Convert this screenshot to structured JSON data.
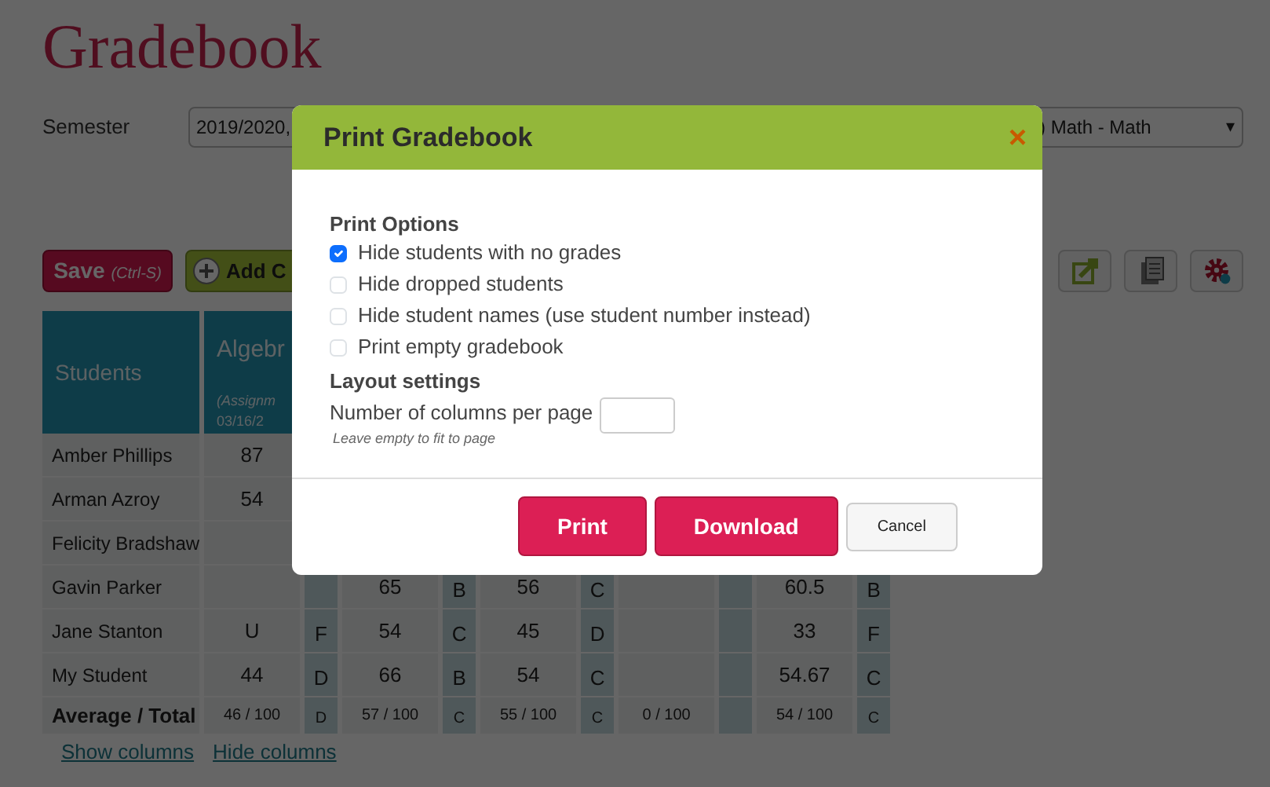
{
  "page_title": "Gradebook",
  "filters": [
    {
      "label": "Semester",
      "value": "2019/2020,"
    },
    {
      "value": ") Math - Math",
      "caret": "▾"
    }
  ],
  "toolbar": {
    "save": {
      "label": "Save",
      "shortcut": "(Ctrl-S)"
    },
    "add": {
      "label": "Add C"
    }
  },
  "table": {
    "columns": [
      {
        "label": "Students"
      },
      {
        "label": "Algebr",
        "subtitle": "(Assignm",
        "date": "03/16/2"
      }
    ],
    "rows": [
      {
        "cells": [
          "Amber Phillips",
          "87"
        ]
      },
      {
        "cells": [
          "Arman Azroy",
          "54"
        ]
      },
      {
        "cells": [
          "Felicity Bradshaw",
          ""
        ]
      },
      {
        "cells": [
          "Gavin Parker",
          "",
          "",
          "65",
          "B",
          "56",
          "C",
          "",
          "",
          "60.5",
          "B"
        ]
      },
      {
        "cells": [
          "Jane Stanton",
          "U",
          "F",
          "54",
          "C",
          "45",
          "D",
          "",
          "",
          "33",
          "F"
        ]
      },
      {
        "cells": [
          "My Student",
          "44",
          "D",
          "66",
          "B",
          "54",
          "C",
          "",
          "",
          "54.67",
          "C"
        ]
      },
      {
        "kind": "total",
        "cells": [
          "Average / Total",
          "46 / 100",
          "D",
          "57 / 100",
          "C",
          "55 / 100",
          "C",
          "0 / 100",
          "",
          "54 / 100",
          "C"
        ]
      }
    ]
  },
  "links": [
    "Show columns",
    "Hide columns"
  ],
  "dialog": {
    "title": "Print Gradebook",
    "close": "×",
    "sections": [
      {
        "heading": "Print Options",
        "options": [
          {
            "label": "Hide students with no grades",
            "checked": true
          },
          {
            "label": "Hide dropped students",
            "checked": false
          },
          {
            "label": "Hide student names (use student number instead)",
            "checked": false
          },
          {
            "label": "Print empty gradebook",
            "checked": false
          }
        ]
      },
      {
        "heading": "Layout settings",
        "field": {
          "label": "Number of columns per page",
          "hint": "Leave empty to fit to page"
        }
      }
    ],
    "buttons": [
      {
        "label": "Print",
        "kind": "primary"
      },
      {
        "label": "Download",
        "kind": "primary"
      },
      {
        "label": "Cancel",
        "kind": "secondary"
      }
    ]
  }
}
